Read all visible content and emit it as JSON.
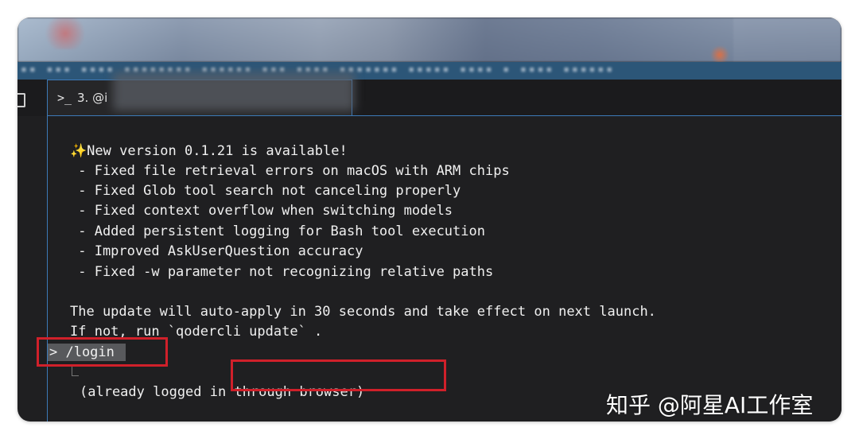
{
  "tab": {
    "label": "3. @i"
  },
  "terminal": {
    "lines": [
      "New version 0.1.21 is available!",
      " - Fixed file retrieval errors on macOS with ARM chips",
      " - Fixed Glob tool search not canceling properly",
      " - Fixed context overflow when switching models",
      " - Added persistent logging for Bash tool execution",
      " - Improved AskUserQuestion accuracy",
      " - Fixed -w parameter not recognizing relative paths",
      "The update will auto-apply in 30 seconds and take effect on next launch.",
      "If not, run `qodercli update` ."
    ],
    "command": "> /login",
    "response": "(already logged in through browser)"
  },
  "watermark": "知乎 @阿星AI工作室",
  "colors": {
    "terminal_bg": "#1f1f21",
    "path_bar": "#2c5678",
    "tab_accent": "#3d7ab8",
    "highlight_box": "#d0202a",
    "selection_bg": "#58595c",
    "sparkle": "#f2c94c"
  },
  "icons": {
    "sparkle": "sparkle-icon",
    "prompt": "terminal-prompt-icon",
    "layout": "split-layout-icon"
  }
}
